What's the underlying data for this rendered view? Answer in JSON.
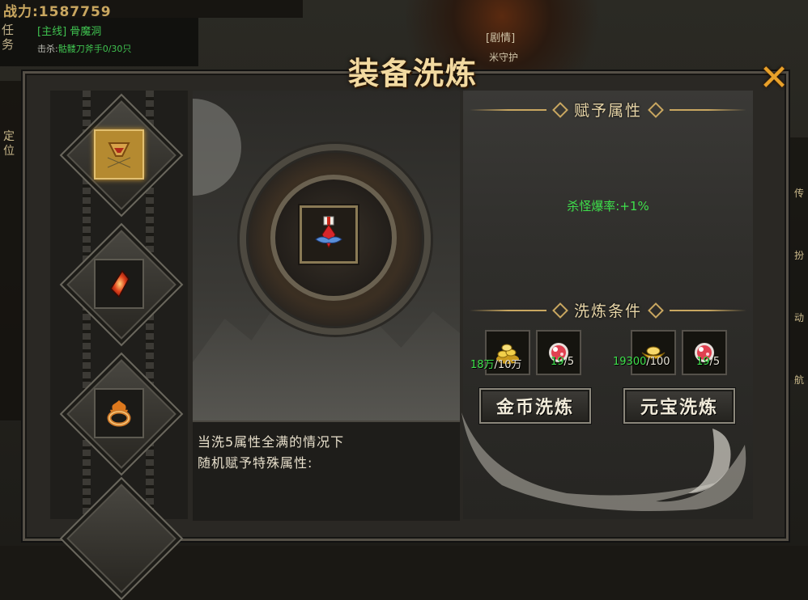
{
  "hud": {
    "power_label": "战力:1587759",
    "quest_tab": "任务",
    "quest_title": "[主线] 骨魔洞",
    "quest_kill_prefix": "击杀:",
    "quest_kill_target": "骷髅刀斧手0/30只",
    "locate_label": "定位",
    "story_badge": "[剧情]",
    "guard_label": "米守护",
    "right_strip_labels": [
      "传",
      "扮",
      "动",
      "航"
    ]
  },
  "dialog": {
    "title": "装备洗炼",
    "close_symbol": "✕"
  },
  "slots": [
    {
      "name": "helmet",
      "icon": "helmet-icon",
      "active": true
    },
    {
      "name": "gem",
      "icon": "red-crystal-icon",
      "active": false
    },
    {
      "name": "ring",
      "icon": "fire-ring-icon",
      "active": false
    }
  ],
  "center": {
    "equipped_icon": "medal-icon",
    "description_line1": "当洗5属性全满的情况下",
    "description_line2": "随机赋予特殊属性:"
  },
  "attributes": {
    "header": "赋予属性",
    "value": "杀怪爆率:+1%"
  },
  "conditions": {
    "header": "洗炼条件",
    "gold_cost": {
      "icon": "gold-coins-icon",
      "have": "18万",
      "need": "/10万"
    },
    "gold_stone": {
      "icon": "red-stone-icon",
      "have": "19",
      "need": "/5"
    },
    "yuanbao_cost": {
      "icon": "yuanbao-icon",
      "have": "19300",
      "need": "/100"
    },
    "yuanbao_stone": {
      "icon": "red-stone-icon",
      "have": "19",
      "need": "/5"
    }
  },
  "buttons": {
    "gold_refine": "金币洗炼",
    "yuanbao_refine": "元宝洗炼"
  },
  "colors": {
    "accent_gold": "#c9a760",
    "positive_green": "#3ee04b",
    "title_gold": "#f2d9a0",
    "close_orange": "#e8a12a"
  }
}
